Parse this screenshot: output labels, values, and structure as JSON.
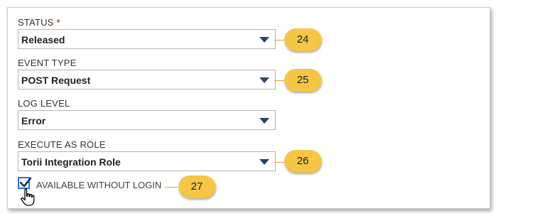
{
  "fields": [
    {
      "label": "STATUS",
      "required_mark": "*",
      "value": "Released",
      "callout": "24"
    },
    {
      "label": "EVENT TYPE",
      "value": "POST Request",
      "callout": "25"
    },
    {
      "label": "LOG LEVEL",
      "value": "Error"
    },
    {
      "label": "EXECUTE AS ROLE",
      "value": "Torii Integration Role",
      "callout": "26"
    }
  ],
  "checkbox": {
    "label": "AVAILABLE WITHOUT LOGIN",
    "checked": true,
    "callout": "27"
  },
  "colors": {
    "callout_fill": "#f6c644",
    "caret": "#2c4363",
    "checkbox_border": "#2f6fdb",
    "required": "#c0641f"
  },
  "icons": {
    "dropdown": "caret-down-icon",
    "check": "check-icon",
    "cursor": "hand-pointer-icon"
  }
}
